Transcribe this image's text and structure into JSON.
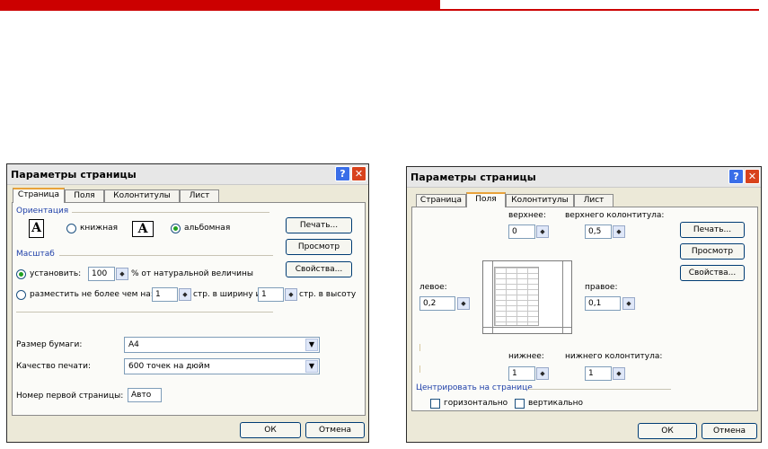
{
  "left_dialog": {
    "title": "Параметры страницы",
    "help": "?",
    "close": "✕",
    "tabs": [
      "Страница",
      "Поля",
      "Колонтитулы",
      "Лист"
    ],
    "orientation": {
      "title": "Ориентация",
      "portrait_label": "книжная",
      "landscape_label": "альбомная",
      "portrait_icon": "A",
      "landscape_icon": "A",
      "selected": "альбомная"
    },
    "scale": {
      "title": "Масштаб",
      "set_label": "установить:",
      "set_value": "100",
      "set_suffix": "% от натуральной величины",
      "fit_label": "разместить не более чем на:",
      "fit_width_value": "1",
      "fit_width_suffix": "стр. в ширину и",
      "fit_height_value": "1",
      "fit_height_suffix": "стр. в высоту"
    },
    "paper_size_label": "Размер бумаги:",
    "paper_size_value": "A4",
    "print_quality_label": "Качество печати:",
    "print_quality_value": "600 точек на дюйм",
    "first_page_label": "Номер первой страницы:",
    "first_page_value": "Авто",
    "buttons": {
      "print": "Печать...",
      "preview": "Просмотр",
      "properties": "Свойства...",
      "ok": "ОК",
      "cancel": "Отмена"
    }
  },
  "right_dialog": {
    "title": "Параметры страницы",
    "help": "?",
    "close": "✕",
    "tabs": [
      "Страница",
      "Поля",
      "Колонтитулы",
      "Лист"
    ],
    "top_label": "верхнее:",
    "top_value": "0",
    "header_label": "верхнего колонтитула:",
    "header_value": "0,5",
    "left_label": "левое:",
    "left_value": "0,2",
    "right_label": "правое:",
    "right_value": "0,1",
    "bottom_label": "нижнее:",
    "bottom_value": "1",
    "footer_label": "нижнего колонтитула:",
    "footer_value": "1",
    "center_title": "Центрировать на странице",
    "horizontal_label": "горизонтально",
    "vertical_label": "вертикально",
    "buttons": {
      "print": "Печать...",
      "preview": "Просмотр",
      "properties": "Свойства...",
      "ok": "ОК",
      "cancel": "Отмена"
    }
  },
  "colors": {
    "red_bar": "#cc0000",
    "group_title": "#1e3fa8",
    "dialog_bg": "#ece9d8"
  }
}
